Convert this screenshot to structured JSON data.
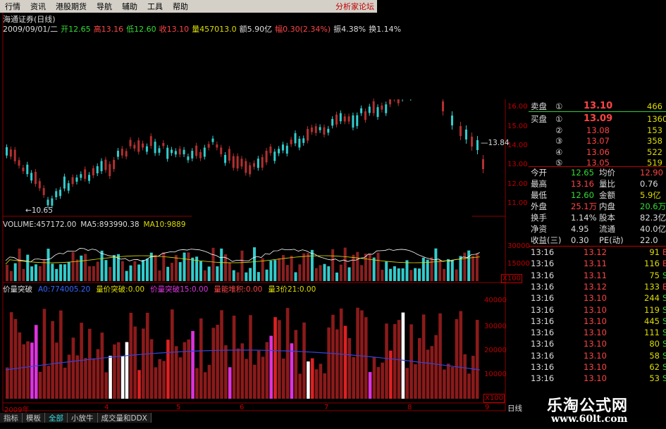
{
  "menu": {
    "items": [
      "行情",
      "资讯",
      "港股期货",
      "导航",
      "辅助",
      "工具",
      "帮助"
    ],
    "right_text": "分析家论坛"
  },
  "stock": {
    "title": "海通证券(日线)",
    "date": "2009/09/01/二",
    "open": "开12.65",
    "high": "高13.16",
    "low": "低12.60",
    "close": "收13.10",
    "volume": "量457013.0",
    "amount": "额5.90亿",
    "change": "幅0.30(2.34%)",
    "amplitude": "振4.38%",
    "turnover": "换1.14%"
  },
  "price_chart": {
    "low_marker": "10.65",
    "high_marker": "13.84",
    "axis": [
      "16.00",
      "15.00",
      "14.00",
      "13.00",
      "12.00",
      "11.00"
    ]
  },
  "volume_panel": {
    "volume": "VOLUME:457172.00",
    "ma5": "MA5:893990.38",
    "ma10": "MA10:9889",
    "axis": [
      "30000",
      "15000"
    ],
    "unit": "X100"
  },
  "indicator_panel": {
    "name": "价量突破",
    "a": "A0:774005.20",
    "b": "量价突破:0.00",
    "c": "价量突破15:0.00",
    "d": "量能堆积:0.00",
    "e": "量3价21:0.00",
    "axis": [
      "40000",
      "30000",
      "20000",
      "10000"
    ],
    "unit": "X100"
  },
  "x_axis": {
    "labels": [
      "2009年",
      "4",
      "5",
      "6",
      "7",
      "8",
      "9"
    ],
    "period": "日线"
  },
  "quote": {
    "sell1": {
      "label": "卖盘",
      "idx": "①",
      "price": "13.10",
      "vol": "466"
    },
    "buy": [
      {
        "label": "买盘",
        "idx": "①",
        "price": "13.09",
        "vol": "1360"
      },
      {
        "label": "",
        "idx": "②",
        "price": "13.08",
        "vol": "153"
      },
      {
        "label": "",
        "idx": "③",
        "price": "13.07",
        "vol": "358"
      },
      {
        "label": "",
        "idx": "④",
        "price": "13.06",
        "vol": "522"
      },
      {
        "label": "",
        "idx": "⑤",
        "price": "13.05",
        "vol": "519"
      }
    ],
    "stats": [
      {
        "k1": "今开",
        "v1": "12.65",
        "c1": "g",
        "k2": "均价",
        "v2": "12.90",
        "c2": "r"
      },
      {
        "k1": "最高",
        "v1": "13.16",
        "c1": "r",
        "k2": "量比",
        "v2": "0.76",
        "c2": "w"
      },
      {
        "k1": "最低",
        "v1": "12.60",
        "c1": "g",
        "k2": "金额",
        "v2": "5.9亿",
        "c2": "y"
      },
      {
        "k1": "外盘",
        "v1": "25.1万",
        "c1": "r",
        "k2": "内盘",
        "v2": "20.6万",
        "c2": "g"
      },
      {
        "k1": "换手",
        "v1": "1.14%",
        "c1": "w",
        "k2": "股本",
        "v2": "82.3亿",
        "c2": "w"
      },
      {
        "k1": "净资",
        "v1": "4.95",
        "c1": "w",
        "k2": "流通",
        "v2": "40.0亿",
        "c2": "w"
      },
      {
        "k1": "收益(三)",
        "v1": "0.30",
        "c1": "w",
        "k2": "PE(动)",
        "v2": "22.0",
        "c2": "w"
      }
    ],
    "ticks": [
      {
        "t": "13:16",
        "p": "13.12",
        "v": "91",
        "d": "B"
      },
      {
        "t": "13:16",
        "p": "13.11",
        "v": "116",
        "d": "B"
      },
      {
        "t": "13:16",
        "p": "13.11",
        "v": "75",
        "d": "S"
      },
      {
        "t": "13:16",
        "p": "13.12",
        "v": "133",
        "d": "B"
      },
      {
        "t": "13:16",
        "p": "13.10",
        "v": "244",
        "d": "S"
      },
      {
        "t": "13:16",
        "p": "13.10",
        "v": "119",
        "d": "S"
      },
      {
        "t": "13:16",
        "p": "13.10",
        "v": "445",
        "d": "S"
      },
      {
        "t": "13:16",
        "p": "13.10",
        "v": "111",
        "d": "S"
      },
      {
        "t": "13:16",
        "p": "13.10",
        "v": "80",
        "d": "S"
      },
      {
        "t": "13:16",
        "p": "13.10",
        "v": "58",
        "d": "S"
      },
      {
        "t": "13:16",
        "p": "13.10",
        "v": "62",
        "d": "S"
      },
      {
        "t": "13:16",
        "p": "13.10",
        "v": "53",
        "d": "S"
      }
    ]
  },
  "tabs": [
    "指标",
    "模板",
    "全部",
    "小放牛",
    "成交量和DDX"
  ],
  "logo": {
    "title": "乐淘公式网",
    "url": "www.60lt.com"
  },
  "colors": {
    "up": "#d03a3a",
    "down": "#33cccc",
    "accent_red": "#c00000"
  }
}
